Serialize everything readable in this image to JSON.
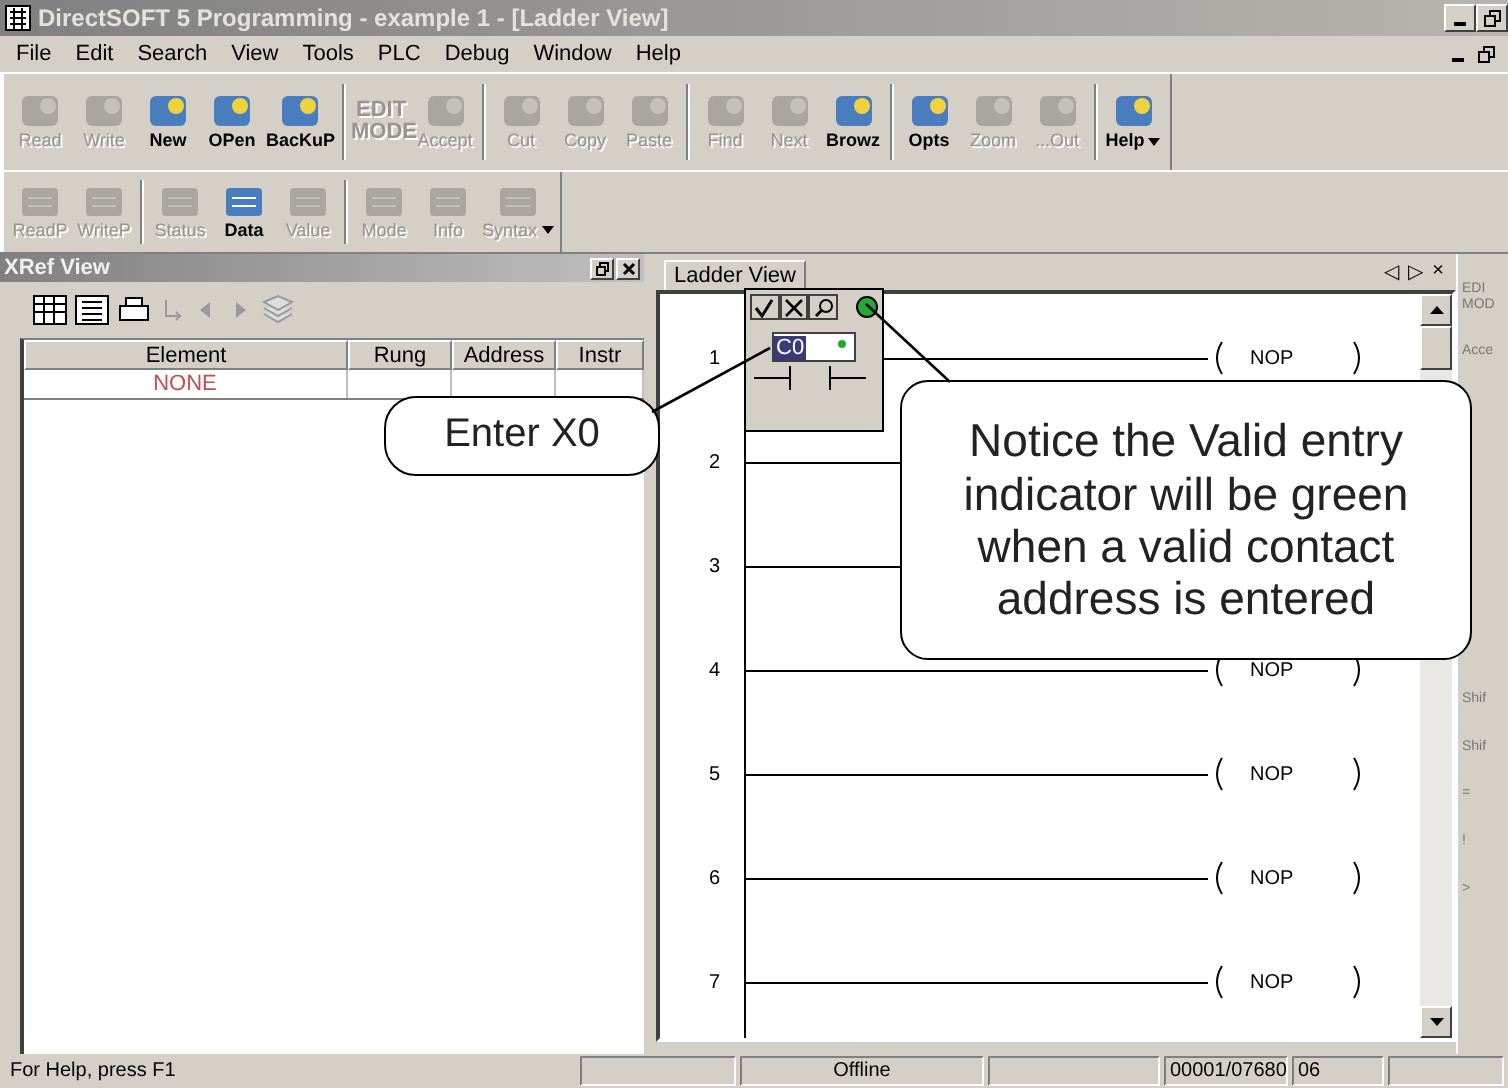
{
  "window": {
    "title": "DirectSOFT 5 Programming - example 1 - [Ladder View]"
  },
  "menu": [
    "File",
    "Edit",
    "Search",
    "View",
    "Tools",
    "PLC",
    "Debug",
    "Window",
    "Help"
  ],
  "toolbar_1": [
    [
      {
        "label": "Read",
        "enabled": false
      },
      {
        "label": "Write",
        "enabled": false
      },
      {
        "label": "New",
        "enabled": true
      },
      {
        "label": "OPen",
        "enabled": true
      },
      {
        "label": "BacKuP",
        "enabled": true
      }
    ],
    [
      {
        "label": "EDIT MODE",
        "enabled": false,
        "kind": "text"
      },
      {
        "label": "Accept",
        "enabled": false
      }
    ],
    [
      {
        "label": "Cut",
        "enabled": false
      },
      {
        "label": "Copy",
        "enabled": false
      },
      {
        "label": "Paste",
        "enabled": false
      }
    ],
    [
      {
        "label": "Find",
        "enabled": false
      },
      {
        "label": "Next",
        "enabled": false
      },
      {
        "label": "Browz",
        "enabled": true
      }
    ],
    [
      {
        "label": "Opts",
        "enabled": true
      },
      {
        "label": "Zoom",
        "enabled": false
      },
      {
        "label": "...Out",
        "enabled": false
      }
    ],
    [
      {
        "label": "Help",
        "enabled": true,
        "dropdown": true
      }
    ]
  ],
  "toolbar_2": [
    [
      {
        "label": "ReadP",
        "enabled": false
      },
      {
        "label": "WriteP",
        "enabled": false
      }
    ],
    [
      {
        "label": "Status",
        "enabled": false
      },
      {
        "label": "Data",
        "enabled": true
      },
      {
        "label": "Value",
        "enabled": false
      }
    ],
    [
      {
        "label": "Mode",
        "enabled": false
      },
      {
        "label": "Info",
        "enabled": false
      },
      {
        "label": "Syntax",
        "enabled": false,
        "dropdown": true
      }
    ]
  ],
  "xref": {
    "title": "XRef View",
    "columns": [
      "Element",
      "Rung",
      "Address",
      "Instr"
    ],
    "rows": [
      [
        "NONE"
      ]
    ]
  },
  "ladder": {
    "tab": "Ladder View",
    "nav": [
      "◁",
      "▷",
      "×"
    ],
    "rungs": [
      {
        "number": "1",
        "coil": "NOP"
      },
      {
        "number": "2"
      },
      {
        "number": "3"
      },
      {
        "number": "4",
        "coil": "NOP"
      },
      {
        "number": "5",
        "coil": "NOP"
      },
      {
        "number": "6",
        "coil": "NOP"
      },
      {
        "number": "7",
        "coil": "NOP"
      }
    ],
    "editor": {
      "value": "C0",
      "valid": true
    }
  },
  "side_strip": [
    "EDI MOD",
    "Acce",
    "Shif",
    "Shif",
    "=",
    "!",
    ">"
  ],
  "callouts": [
    "Enter X0",
    "Notice the Valid entry indicator will be green when a valid contact address is entered"
  ],
  "status_bar": [
    "For Help, press F1",
    "Offline",
    "00001/07680",
    "06"
  ]
}
